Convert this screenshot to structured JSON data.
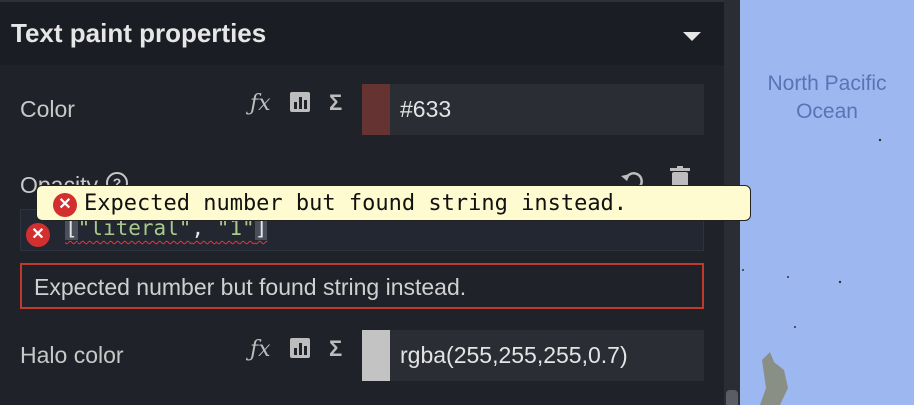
{
  "panel": {
    "title": "Text paint properties"
  },
  "properties": {
    "color": {
      "label": "Color",
      "value": "#633",
      "swatch": "#663333"
    },
    "opacity": {
      "label": "Opacity",
      "expression": {
        "open": "[",
        "arg1": "\"literal\"",
        "sep": ", ",
        "arg2": "\"1\"",
        "close": "]"
      },
      "error": "Expected number but found string instead.",
      "tooltip": "Expected number but found string instead."
    },
    "halo_color": {
      "label": "Halo color",
      "value": "rgba(255,255,255,0.7)",
      "swatch": "#c3c3c3"
    }
  },
  "tools": {
    "function": "ƒx",
    "data": "▣",
    "sum": "Σ"
  },
  "map": {
    "label_line1": "North Pacific",
    "label_line2": "Ocean",
    "water_color": "#9db8f0"
  }
}
